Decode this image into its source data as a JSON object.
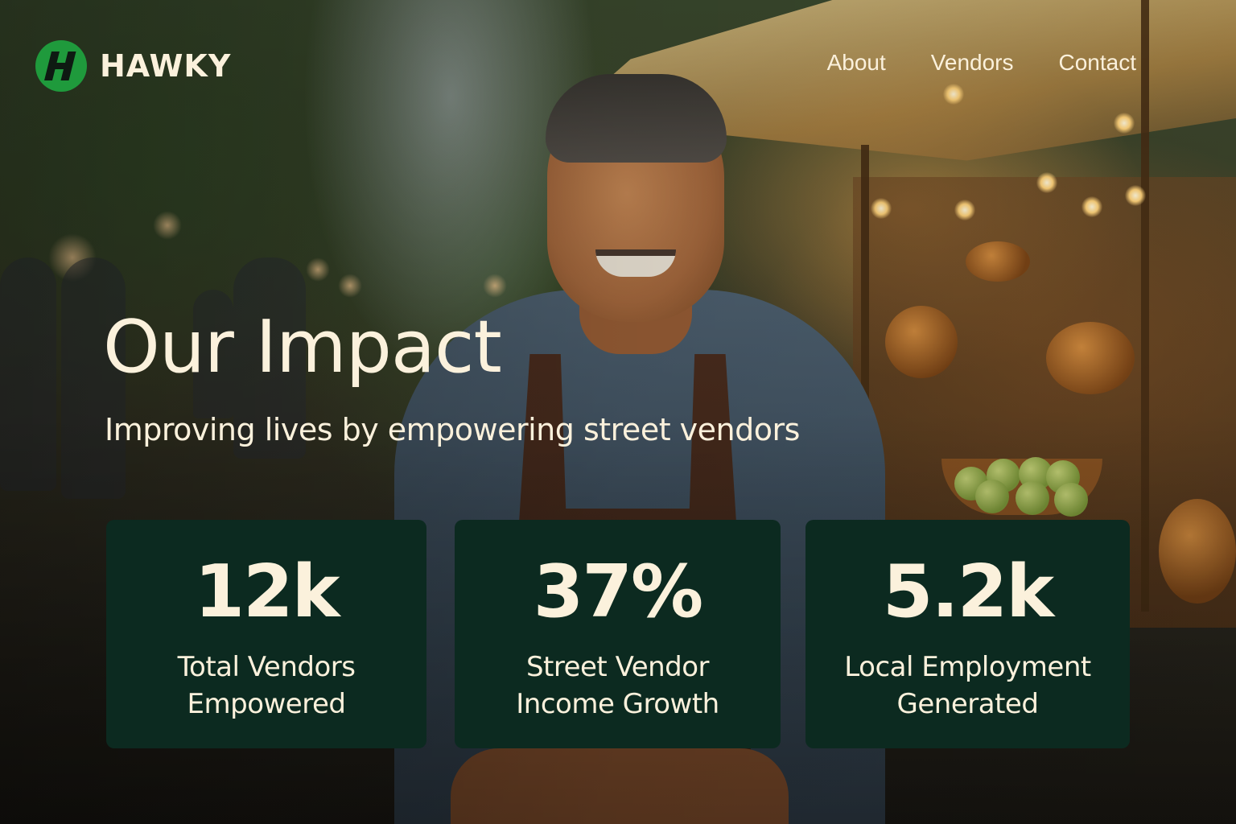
{
  "brand": {
    "name": "HAWKY",
    "logo_icon": "hawky-h-logo-icon",
    "accent_color": "#1f9a3c"
  },
  "nav": {
    "items": [
      {
        "label": "About"
      },
      {
        "label": "Vendors"
      },
      {
        "label": "Contact"
      }
    ]
  },
  "hero": {
    "title": "Our Impact",
    "subtitle": "Improving lives by empowering street vendors"
  },
  "stats": [
    {
      "value": "12k",
      "label": "Total Vendors\nEmpowered"
    },
    {
      "value": "37%",
      "label": "Street Vendor\nIncome Growth"
    },
    {
      "value": "5.2k",
      "label": "Local Employment\nGenerated"
    }
  ],
  "colors": {
    "card_background": "#0c2a20",
    "text": "#fbf1dc"
  }
}
